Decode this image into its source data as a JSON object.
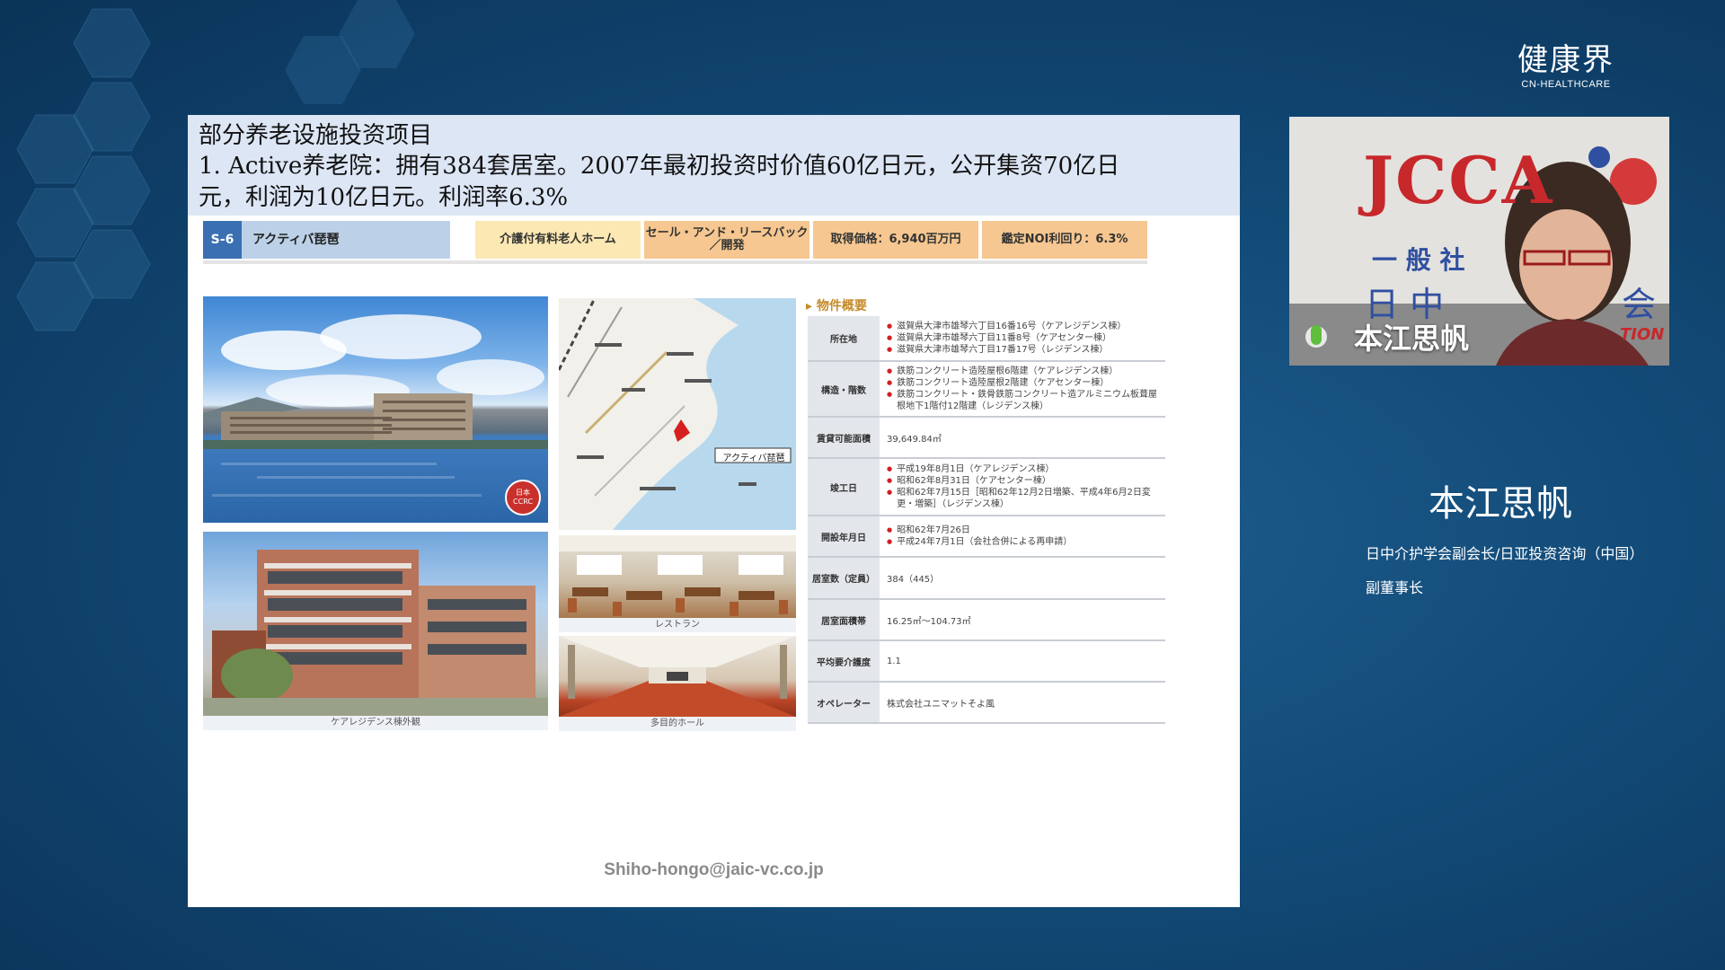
{
  "brand": {
    "cn": "健康界",
    "en": "CN-HEALTHCARE"
  },
  "slide": {
    "line1": "部分养老设施投资项目",
    "line2": "1. Active养老院：拥有384套居室。2007年最初投资时价值60亿日元，公开集资70亿日",
    "line3": "元，利润为10亿日元。利润率6.3%",
    "chip_code": "S-6",
    "chip_name": "アクティバ琵琶",
    "chips": [
      "介護付有料老人ホーム",
      "セール・アンド・リースバック／開発",
      "取得価格：6,940百万円",
      "鑑定NOI利回り：6.3%"
    ],
    "captions": {
      "restaurant": "レストラン",
      "hall": "多目的ホール",
      "building": "ケアレジデンス棟外観"
    },
    "map_label": "アクティバ琵琶",
    "seal": "日本 CCRC",
    "property": {
      "title": "物件概要",
      "rows": [
        {
          "key": "所在地",
          "vals": [
            "滋賀県大津市雄琴六丁目16番16号（ケアレジデンス棟）",
            "滋賀県大津市雄琴六丁目11番8号（ケアセンター棟）",
            "滋賀県大津市雄琴六丁目17番17号（レジデンス棟）"
          ]
        },
        {
          "key": "構造・階数",
          "vals": [
            "鉄筋コンクリート造陸屋根6階建（ケアレジデンス棟）",
            "鉄筋コンクリート造陸屋根2階建（ケアセンター棟）",
            "鉄筋コンクリート・鉄骨鉄筋コンクリート造アルミニウム板葺屋根地下1階付12階建（レジデンス棟）"
          ]
        },
        {
          "key": "賃貸可能面積",
          "vals": [
            "39,649.84㎡"
          ]
        },
        {
          "key": "竣工日",
          "vals": [
            "平成19年8月1日（ケアレジデンス棟）",
            "昭和62年8月31日（ケアセンター棟）",
            "昭和62年7月15日［昭和62年12月2日増築、平成4年6月2日変更・増築］（レジデンス棟）"
          ]
        },
        {
          "key": "開設年月日",
          "vals": [
            "昭和62年7月26日",
            "平成24年7月1日（会社合併による再申請）"
          ]
        },
        {
          "key": "居室数（定員）",
          "vals": [
            "384（445）"
          ]
        },
        {
          "key": "居室面積帯",
          "vals": [
            "16.25㎡～104.73㎡"
          ]
        },
        {
          "key": "平均要介護度",
          "vals": [
            "1.1"
          ]
        },
        {
          "key": "オペレーター",
          "vals": [
            "株式会社ユニマットそよ風"
          ]
        }
      ]
    },
    "email": "Shiho-hongo@jaic-vc.co.jp"
  },
  "video": {
    "logo_text": "JCCA",
    "bg_text": "一 般 社",
    "bg_text2": "日 中",
    "bg_text3": "会",
    "bg_text4": "TION",
    "name_overlay": "本江思帆"
  },
  "speaker": {
    "name": "本江思帆",
    "title_line1": "日中介护学会副会长/日亚投资咨询（中国）",
    "title_line2": "副董事长"
  }
}
